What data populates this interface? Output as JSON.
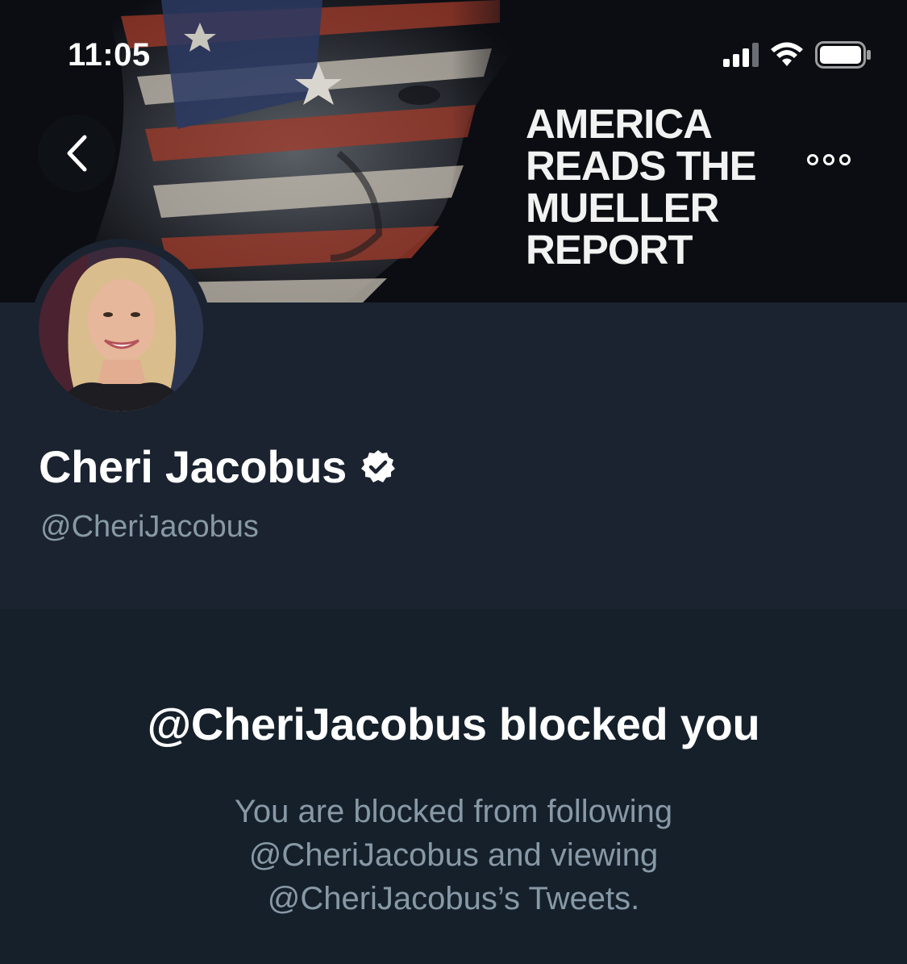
{
  "status_bar": {
    "time": "11:05",
    "icons": [
      "signal-icon",
      "wifi-icon",
      "battery-icon"
    ]
  },
  "banner": {
    "headline_lines": [
      "AMERICA",
      "READS THE",
      "MUELLER",
      "REPORT"
    ]
  },
  "navigation": {
    "back_icon": "chevron-left-icon",
    "more_icon": "more-icon"
  },
  "profile": {
    "display_name": "Cheri Jacobus",
    "verified_icon": "verified-badge-icon",
    "handle": "@CheriJacobus"
  },
  "blocked": {
    "title": "@CheriJacobus blocked you",
    "description": "You are blocked from following @CheriJacobus and viewing @CheriJacobus’s Tweets."
  },
  "colors": {
    "background": "#15202b",
    "profile_background": "#1b2330",
    "secondary_text": "#8899a6",
    "primary_text": "#ffffff"
  }
}
